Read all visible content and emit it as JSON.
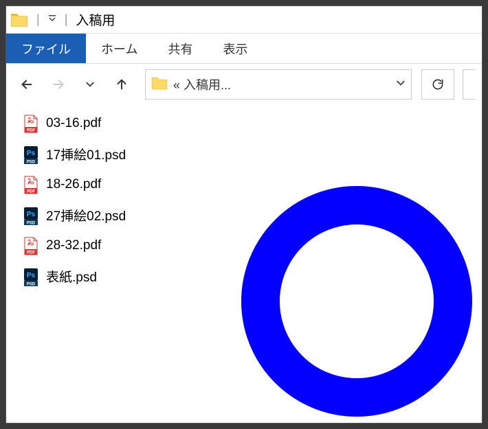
{
  "window": {
    "title": "入稿用"
  },
  "ribbon": {
    "file": "ファイル",
    "home": "ホーム",
    "share": "共有",
    "view": "表示"
  },
  "breadcrumb": {
    "label": "« 入稿用..."
  },
  "files": [
    {
      "name": "03-16.pdf",
      "type": "pdf"
    },
    {
      "name": "17挿絵01.psd",
      "type": "psd"
    },
    {
      "name": "18-26.pdf",
      "type": "pdf"
    },
    {
      "name": "27挿絵02.psd",
      "type": "psd"
    },
    {
      "name": "28-32.pdf",
      "type": "pdf"
    },
    {
      "name": "表紙.psd",
      "type": "psd"
    }
  ]
}
